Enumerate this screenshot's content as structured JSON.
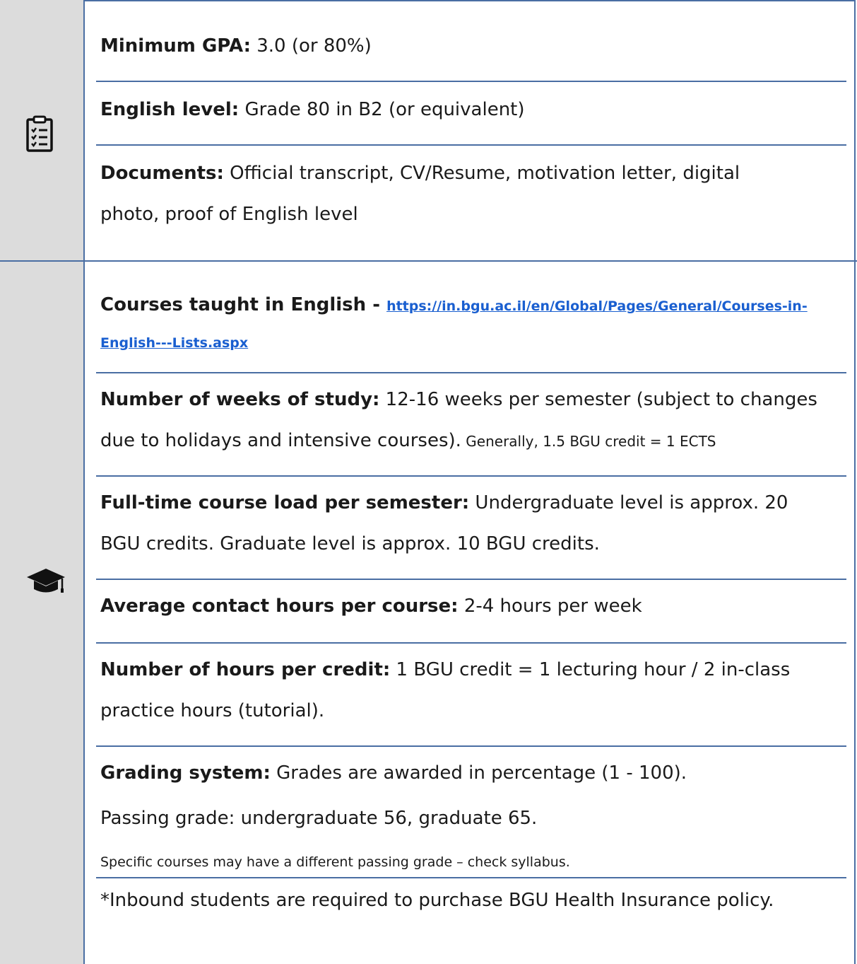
{
  "requirements": {
    "gpa_label": "Minimum GPA:",
    "gpa_value": " 3.0 (or 80%)",
    "english_label": "English level:",
    "english_value": " Grade 80 in B2 (or equivalent)",
    "documents_label": "Documents:",
    "documents_value_line1": " Official transcript, CV/Resume, motivation letter, digital",
    "documents_value_line2": "photo, proof of English level"
  },
  "academics": {
    "courses_label": "Courses taught in English - ",
    "courses_link_line1": "https://in.bgu.ac.il/en/Global/Pages/General/Courses-in-",
    "courses_link_line2": "English---Lists.aspx",
    "weeks_label": "Number of weeks of study:",
    "weeks_value_line1": " 12-16 weeks per semester (subject to changes",
    "weeks_value_line2": "due to holidays and intensive courses).",
    "weeks_note": " Generally, 1.5 BGU credit = 1 ECTS",
    "load_label": "Full-time course load per semester:",
    "load_value_line1": " Undergraduate level is approx. 20",
    "load_value_line2": "BGU credits. Graduate level is approx. 10 BGU credits.",
    "contact_label": "Average contact hours per course:",
    "contact_value": " 2-4 hours per week",
    "hours_label": "Number of hours per credit:",
    "hours_value_line1": " 1 BGU credit = 1 lecturing hour / 2 in-class",
    "hours_value_line2": "practice hours (tutorial).",
    "grading_label": "Grading system:",
    "grading_value": " Grades are awarded in percentage (1 - 100).",
    "passing_grade": "Passing grade: undergraduate 56, graduate 65.",
    "specific_note": "Specific courses may have a different passing grade – check syllabus.",
    "insurance_note": "*Inbound students are required to purchase BGU Health Insurance policy."
  },
  "icons": {
    "requirements": "clipboard-checklist-icon",
    "academics": "graduation-cap-icon"
  },
  "colors": {
    "border": "#4a6ea3",
    "sidebar": "#dcdcdc",
    "link": "#1a5fd0"
  }
}
